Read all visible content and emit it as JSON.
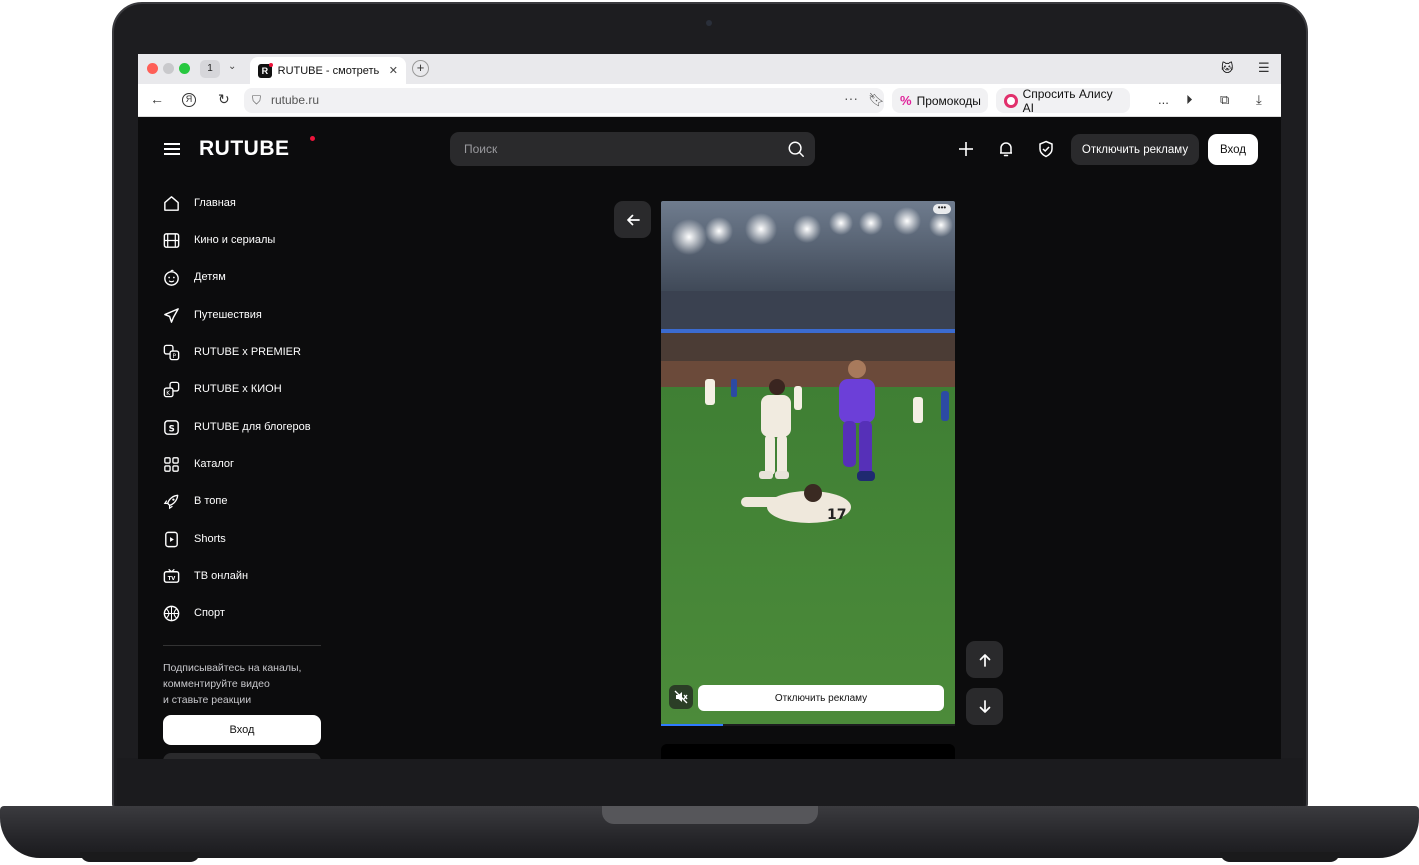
{
  "browser": {
    "tab_count": "1",
    "tab_title": "RUTUBE - смотреть ви",
    "url": "rutube.ru",
    "promo_label": "Промокоды",
    "alice_label": "Спросить Алису AI",
    "overflow_label": "..."
  },
  "header": {
    "logo": "RUTUBE",
    "search_placeholder": "Поиск",
    "disable_ads": "Отключить рекламу",
    "login": "Вход"
  },
  "sidebar": {
    "items": [
      {
        "label": "Главная",
        "icon": "home-icon"
      },
      {
        "label": "Кино и сериалы",
        "icon": "film-icon"
      },
      {
        "label": "Детям",
        "icon": "kids-icon"
      },
      {
        "label": "Путешествия",
        "icon": "plane-icon"
      },
      {
        "label": "RUTUBE x PREMIER",
        "icon": "premier-icon"
      },
      {
        "label": "RUTUBE x КИОН",
        "icon": "kion-icon"
      },
      {
        "label": "RUTUBE для блогеров",
        "icon": "bloggers-icon"
      },
      {
        "label": "Каталог",
        "icon": "catalog-icon"
      },
      {
        "label": "В топе",
        "icon": "rocket-icon"
      },
      {
        "label": "Shorts",
        "icon": "shorts-icon"
      },
      {
        "label": "ТВ онлайн",
        "icon": "tv-icon"
      },
      {
        "label": "Спорт",
        "icon": "ball-icon"
      }
    ],
    "note_line1": "Подписывайтесь на каналы,",
    "note_line2": "комментируйте видео",
    "note_line3": "и ставьте реакции",
    "login": "Вход"
  },
  "player": {
    "ad_button": "Отключить рекламу",
    "progress": 0.21,
    "more_label": "•••"
  },
  "colors": {
    "accent": "#ed143b",
    "page_bg": "#0c0c0d",
    "control_bg": "#2a2a2c",
    "progress": "#2f7bff"
  }
}
